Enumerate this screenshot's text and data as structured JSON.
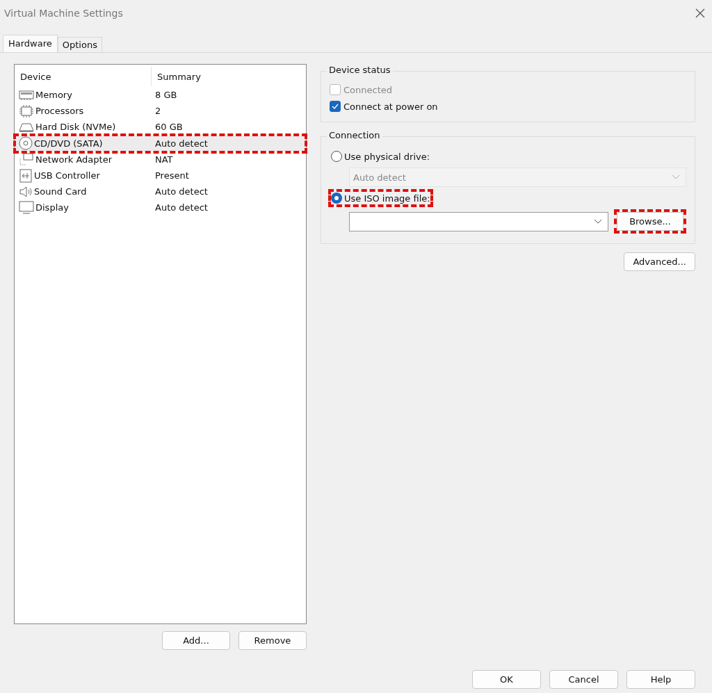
{
  "window": {
    "title": "Virtual Machine Settings"
  },
  "tabs": [
    {
      "label": "Hardware",
      "selected": true
    },
    {
      "label": "Options",
      "selected": false
    }
  ],
  "device_table": {
    "columns": [
      "Device",
      "Summary"
    ],
    "rows": [
      {
        "kind": "memory",
        "device": "Memory",
        "summary": "8 GB",
        "selected": false,
        "highlighted": false
      },
      {
        "kind": "processor",
        "device": "Processors",
        "summary": "2",
        "selected": false,
        "highlighted": false
      },
      {
        "kind": "disk",
        "device": "Hard Disk (NVMe)",
        "summary": "60 GB",
        "selected": false,
        "highlighted": false
      },
      {
        "kind": "cd",
        "device": "CD/DVD (SATA)",
        "summary": "Auto detect",
        "selected": true,
        "highlighted": true
      },
      {
        "kind": "network",
        "device": "Network Adapter",
        "summary": "NAT",
        "selected": false,
        "highlighted": false
      },
      {
        "kind": "usb",
        "device": "USB Controller",
        "summary": "Present",
        "selected": false,
        "highlighted": false
      },
      {
        "kind": "sound",
        "device": "Sound Card",
        "summary": "Auto detect",
        "selected": false,
        "highlighted": false
      },
      {
        "kind": "display",
        "device": "Display",
        "summary": "Auto detect",
        "selected": false,
        "highlighted": false
      }
    ]
  },
  "list_buttons": [
    "Add...",
    "Remove"
  ],
  "device_status": {
    "title": "Device status",
    "options": [
      {
        "label": "Connected",
        "checked": false,
        "disabled": true
      },
      {
        "label": "Connect at power on",
        "checked": true,
        "disabled": false
      }
    ]
  },
  "connection": {
    "title": "Connection",
    "physical": {
      "label": "Use physical drive:",
      "selected": false,
      "highlighted": false,
      "dropdown": {
        "value": "Auto detect",
        "disabled": true
      }
    },
    "iso": {
      "label": "Use ISO image file:",
      "selected": true,
      "highlighted": true,
      "browse": {
        "label": "Browse...",
        "highlighted": true
      }
    }
  },
  "advanced_button": "Advanced...",
  "dialog_buttons": [
    "OK",
    "Cancel",
    "Help"
  ]
}
